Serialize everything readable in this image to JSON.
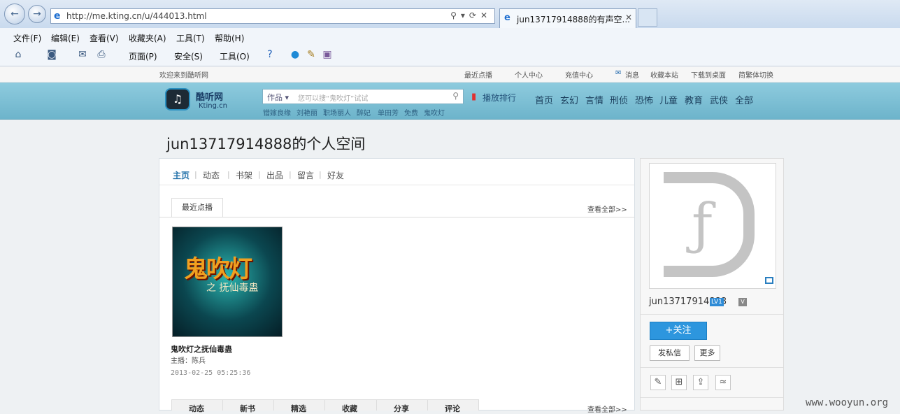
{
  "browser": {
    "address": "http://me.kting.cn/u/444013.html",
    "tab_title": "jun13717914888的有声空...",
    "tab_close": "✕",
    "menus": [
      "文件(F)",
      "编辑(E)",
      "查看(V)",
      "收藏夹(A)",
      "工具(T)",
      "帮助(H)"
    ],
    "commands": {
      "page": "页面(P)",
      "safety": "安全(S)",
      "tools": "工具(O)"
    }
  },
  "site": {
    "welcome": "欢迎来到酷听网",
    "top_links": [
      "最近点播",
      "个人中心",
      "充值中心",
      "消息",
      "收藏本站",
      "下载到桌面",
      "简繁体切换"
    ],
    "logo_name": "酷听网",
    "logo_domain": "Kting.cn",
    "search_category": "作品 ▾",
    "search_placeholder": "您可以搜“鬼吹灯”试试",
    "hot_words": [
      "错嫁良缘",
      "刘艳丽",
      "职场丽人",
      "醉妃",
      "单田芳",
      "免费",
      "鬼吹灯"
    ],
    "rank": "播放排行",
    "nav": [
      "首页",
      "玄幻",
      "言情",
      "刑侦",
      "恐怖",
      "儿童",
      "教育",
      "武侠",
      "全部"
    ]
  },
  "profile": {
    "page_title": "jun13717914888的个人空间",
    "tabs": [
      "主页",
      "动态",
      "书架",
      "出品",
      "留言",
      "好友"
    ],
    "section_tab": "最近点播",
    "view_all": "查看全部>>",
    "book": {
      "cover_title": "鬼吹灯",
      "cover_sub": "之 抚仙毒蛊",
      "title": "鬼吹灯之抚仙毒蛊",
      "host": "主播：陈兵",
      "date": "2013-02-25 05:25:36"
    },
    "bottom_tabs": [
      "动态",
      "新书",
      "精选",
      "收藏",
      "分享",
      "评论"
    ]
  },
  "sidebar": {
    "username": "jun13717914888",
    "level": "LV1",
    "follow": "+关注",
    "message": "发私信",
    "more": "更多"
  },
  "watermark": "www.wooyun.org"
}
